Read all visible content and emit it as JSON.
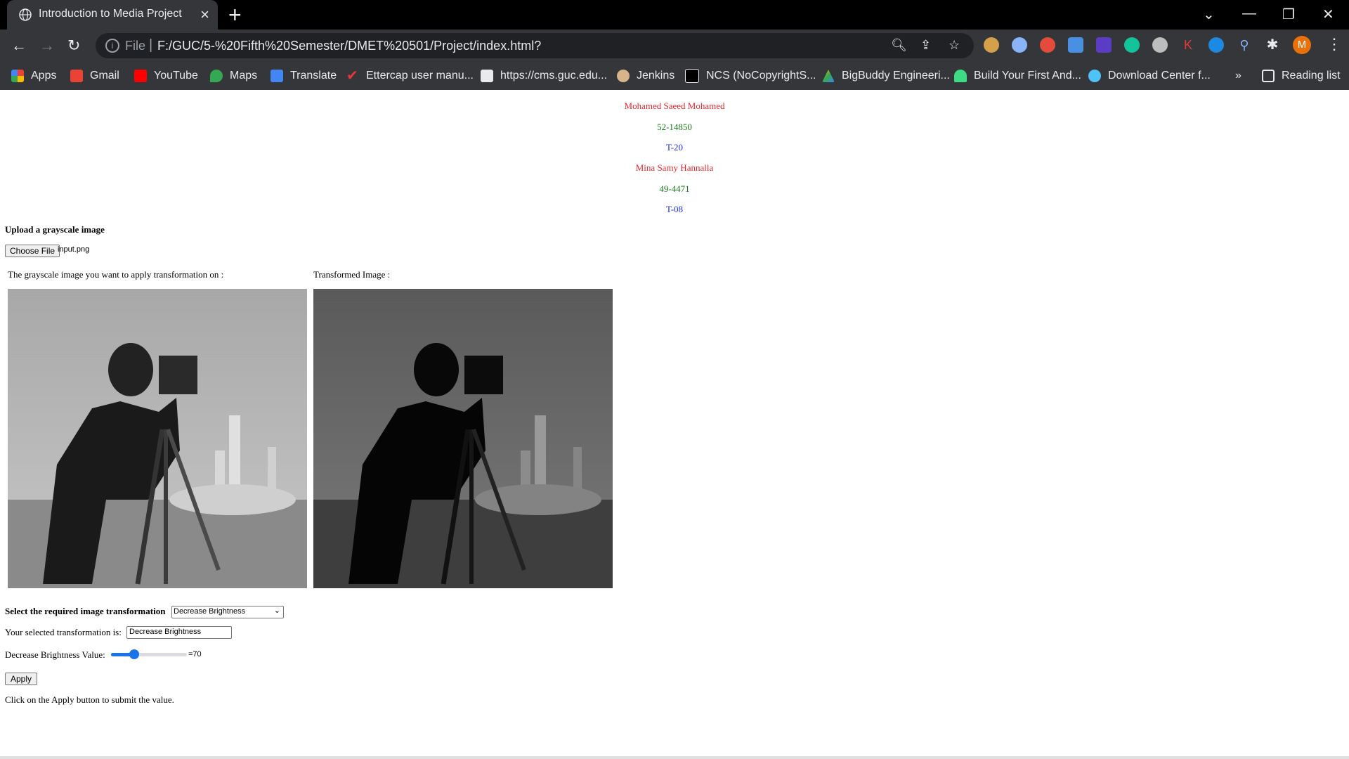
{
  "browser": {
    "tab_title": "Introduction to Media Project",
    "scheme": "File",
    "url": "F:/GUC/5-%20Fifth%20Semester/DMET%20501/Project/index.html?",
    "bookmarks": [
      "Apps",
      "Gmail",
      "YouTube",
      "Maps",
      "Translate",
      "Ettercap user manu...",
      "https://cms.guc.edu...",
      "Jenkins",
      "NCS (NoCopyrightS...",
      "BigBuddy Engineeri...",
      "Build Your First And...",
      "Download Center f..."
    ],
    "overflow": "»",
    "reading_list": "Reading list",
    "avatar_letter": "M"
  },
  "students": [
    {
      "name": "Mohamed Saeed Mohamed",
      "id": "52-14850",
      "tutorial": "T-20"
    },
    {
      "name": "Mina Samy Hannalla",
      "id": "49-4471",
      "tutorial": "T-08"
    }
  ],
  "upload": {
    "heading": "Upload a grayscale image",
    "button": "Choose File",
    "filename": "input.png"
  },
  "images": {
    "original_label": "The grayscale image you want to apply transformation on :",
    "transformed_label": "Transformed Image :"
  },
  "transform": {
    "select_label": "Select the required image transformation",
    "selected": "Decrease Brightness",
    "selected_label": "Your selected transformation is:",
    "selected_value": "Decrease Brightness",
    "slider_label": "Decrease Brightness Value:",
    "slider_value": 70,
    "slider_max": 255,
    "slider_readout": "=70",
    "apply_button": "Apply",
    "hint": "Click on the Apply button to submit the value."
  }
}
